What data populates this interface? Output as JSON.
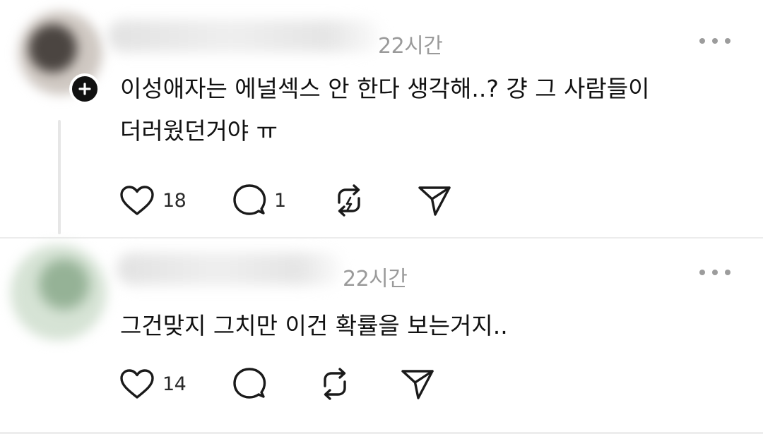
{
  "posts": [
    {
      "time": "22시간",
      "body": "이성애자는 에널섹스 안 한다 생각해..? 걍 그 사람들이\n더러웠던거야 ㅠ",
      "likes": "18",
      "replies": "1",
      "show_follow_badge": true,
      "icons": [
        "heart-icon",
        "comment-icon",
        "repost-icon",
        "share-icon",
        "more-icon",
        "plus-icon"
      ]
    },
    {
      "time": "22시간",
      "body": "그건맞지 그치만 이건 확률을 보는거지..",
      "likes": "14",
      "replies": "",
      "show_follow_badge": false,
      "icons": [
        "heart-icon",
        "comment-icon",
        "repost-icon",
        "share-icon",
        "more-icon"
      ]
    }
  ],
  "colors": {
    "text": "#111111",
    "muted": "#9a9a9a",
    "icon": "#1a1a1a",
    "thread_line": "#e6e6e6"
  }
}
